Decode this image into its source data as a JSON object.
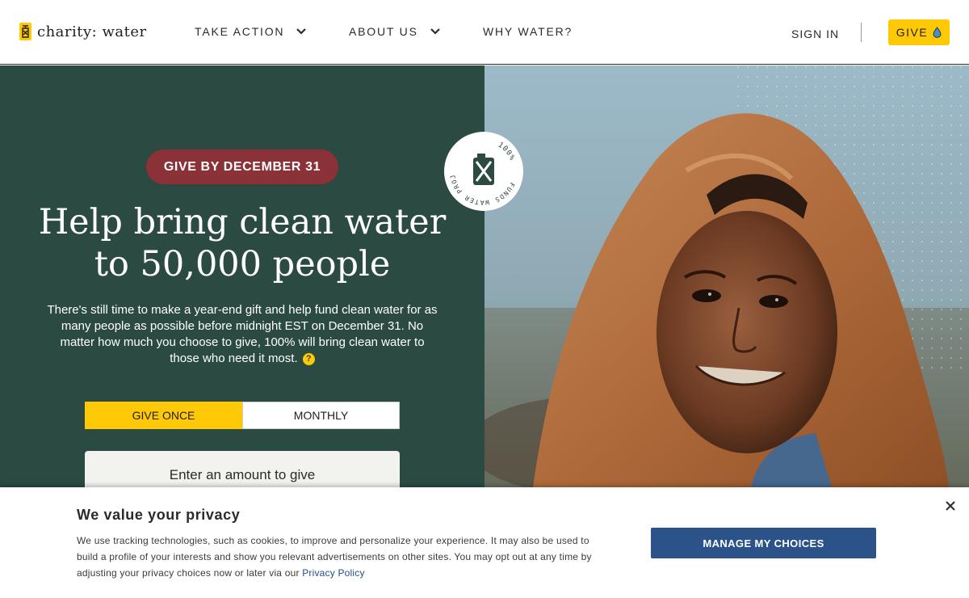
{
  "header": {
    "logo_text": "charity: water",
    "nav": [
      {
        "label": "TAKE ACTION",
        "has_dropdown": true
      },
      {
        "label": "ABOUT US",
        "has_dropdown": true
      },
      {
        "label": "WHY WATER?",
        "has_dropdown": false
      }
    ],
    "sign_in": "SIGN IN",
    "give": "GIVE"
  },
  "hero": {
    "badge": "GIVE BY DECEMBER 31",
    "headline_line1": "Help bring clean water",
    "headline_line2": "to 50,000 people",
    "subtext": "There's still time to make a year-end gift and help fund clean water for as many people as possible before midnight EST on December 31. No matter how much you choose to give, 100% will bring clean water to those who need it most.",
    "help_icon": "?",
    "toggle": {
      "give_once": "GIVE ONCE",
      "monthly": "MONTHLY",
      "selected": "GIVE ONCE"
    },
    "amount_placeholder": "Enter an amount to give",
    "seal": {
      "top": "100%",
      "ring": "FUNDS WATER PROJECTS"
    }
  },
  "privacy": {
    "title": "We value your privacy",
    "text": "We use tracking technologies, such as cookies, to improve and personalize your experience. It may also be used to build a profile of your interests and show you relevant advertisements on other sites. You may opt out at any time by adjusting your privacy choices now or later via our ",
    "link": "Privacy Policy",
    "manage_button": "MANAGE MY CHOICES"
  },
  "colors": {
    "brand_yellow": "#ffc907",
    "hero_green": "#2b4a41",
    "badge_red": "#8a3237",
    "button_blue": "#2b5289"
  },
  "icons": [
    "jerrycan-logo-icon",
    "chevron-down-icon",
    "water-drop-icon",
    "help-circle-icon",
    "close-icon"
  ]
}
